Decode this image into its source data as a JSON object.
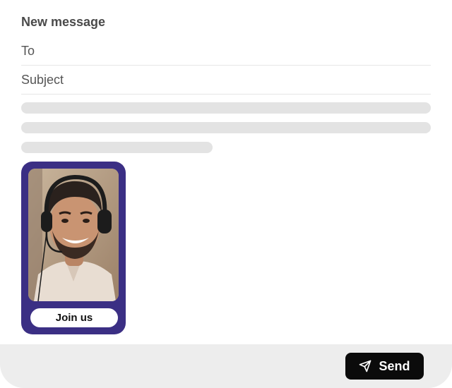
{
  "compose": {
    "title": "New message",
    "to_placeholder": "To",
    "subject_placeholder": "Subject"
  },
  "card": {
    "image_alt": "smiling man with headset",
    "button_label": "Join us",
    "background": "#3b2f84"
  },
  "footer": {
    "send_label": "Send",
    "send_icon": "paper-plane-icon"
  }
}
